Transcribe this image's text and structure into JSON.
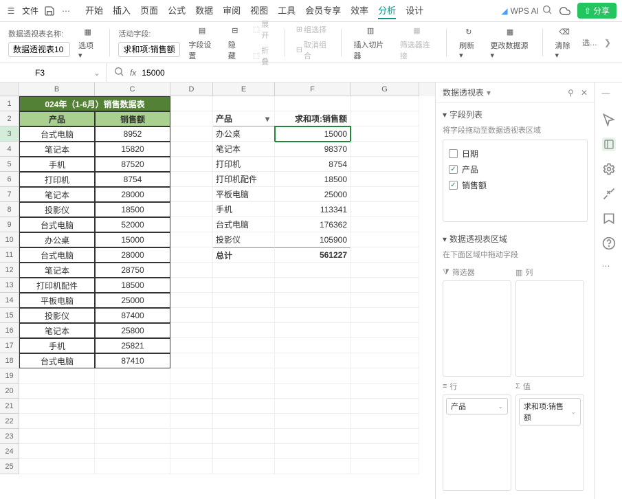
{
  "menubar": {
    "file": "文件",
    "tabs": [
      "开始",
      "插入",
      "页面",
      "公式",
      "数据",
      "审阅",
      "视图",
      "工具",
      "会员专享",
      "效率",
      "分析",
      "设计"
    ],
    "active_tab": "分析",
    "wps_ai": "WPS AI",
    "share": "分享"
  },
  "ribbon": {
    "name_label": "数据透视表名称:",
    "name_value": "数据透视表10",
    "options": "选项",
    "active_field_label": "活动字段:",
    "active_field_value": "求和项:销售额",
    "field_settings": "字段设置",
    "hide": "隐藏",
    "expand": "展开",
    "collapse": "折叠",
    "group_select": "组选择",
    "ungroup": "取消组合",
    "insert_slicer": "插入切片器",
    "filter_conn": "筛选器连接",
    "refresh": "刷新",
    "change_source": "更改数据源",
    "clear": "清除"
  },
  "refbar": {
    "cell": "F3",
    "fx": "fx",
    "formula": "15000"
  },
  "columns": [
    "B",
    "C",
    "D",
    "E",
    "F",
    "G"
  ],
  "title_text": "024年（1-6月）销售数据表",
  "source_headers": {
    "product": "产品",
    "sales": "销售额"
  },
  "source_rows": [
    {
      "p": "台式电脑",
      "s": "8952"
    },
    {
      "p": "笔记本",
      "s": "15820"
    },
    {
      "p": "手机",
      "s": "87520"
    },
    {
      "p": "打印机",
      "s": "8754"
    },
    {
      "p": "笔记本",
      "s": "28000"
    },
    {
      "p": "投影仪",
      "s": "18500"
    },
    {
      "p": "台式电脑",
      "s": "52000"
    },
    {
      "p": "办公桌",
      "s": "15000"
    },
    {
      "p": "台式电脑",
      "s": "28000"
    },
    {
      "p": "笔记本",
      "s": "28750"
    },
    {
      "p": "打印机配件",
      "s": "18500"
    },
    {
      "p": "平板电脑",
      "s": "25000"
    },
    {
      "p": "投影仪",
      "s": "87400"
    },
    {
      "p": "笔记本",
      "s": "25800"
    },
    {
      "p": "手机",
      "s": "25821"
    },
    {
      "p": "台式电脑",
      "s": "87410"
    }
  ],
  "pivot_headers": {
    "row": "产品",
    "val": "求和项:销售额"
  },
  "pivot_rows": [
    {
      "p": "办公桌",
      "s": "15000"
    },
    {
      "p": "笔记本",
      "s": "98370"
    },
    {
      "p": "打印机",
      "s": "8754"
    },
    {
      "p": "打印机配件",
      "s": "18500"
    },
    {
      "p": "平板电脑",
      "s": "25000"
    },
    {
      "p": "手机",
      "s": "113341"
    },
    {
      "p": "台式电脑",
      "s": "176362"
    },
    {
      "p": "投影仪",
      "s": "105900"
    }
  ],
  "pivot_total": {
    "label": "总计",
    "val": "561227"
  },
  "panel": {
    "title": "数据透视表",
    "fields_title": "字段列表",
    "fields_hint": "将字段拖动至数据透视表区域",
    "fields": [
      {
        "name": "日期",
        "checked": false
      },
      {
        "name": "产品",
        "checked": true
      },
      {
        "name": "销售额",
        "checked": true
      }
    ],
    "zones_title": "数据透视表区域",
    "zones_hint": "在下面区域中拖动字段",
    "filter_label": "筛选器",
    "col_label": "列",
    "row_label": "行",
    "val_label": "值",
    "row_items": [
      "产品"
    ],
    "val_items": [
      "求和项:销售额"
    ]
  }
}
